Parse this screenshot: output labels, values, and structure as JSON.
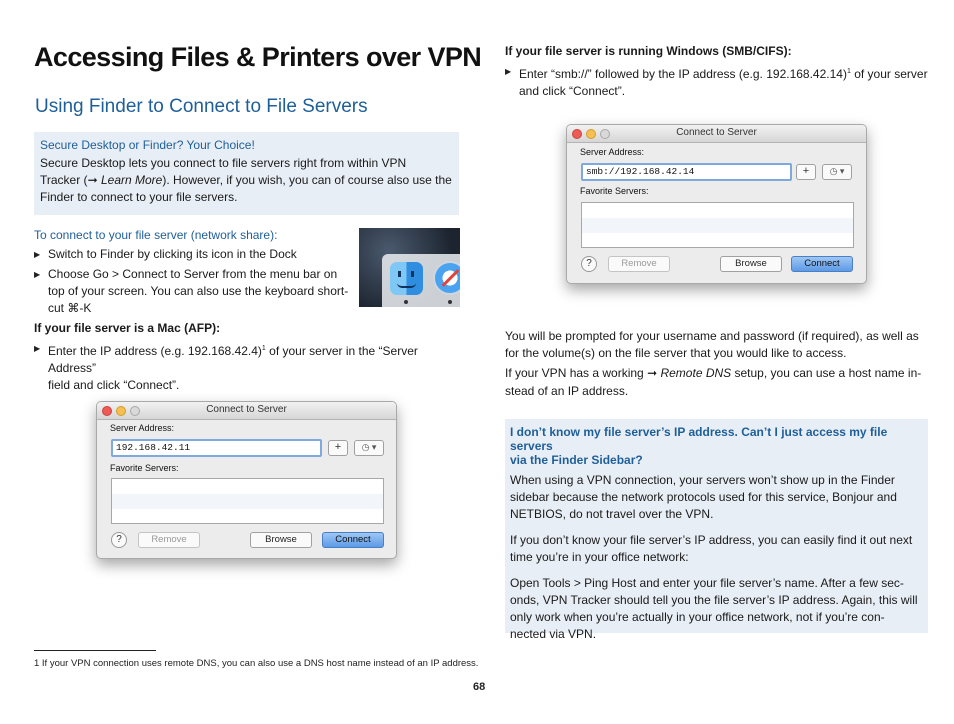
{
  "page_title": "Accessing Files & Printers over VPN",
  "section_title": "Using Finder to Connect to File Servers",
  "tip_box": {
    "title": "Secure Desktop or Finder? Your Choice!",
    "line1": "Secure Desktop lets you connect to file servers right from within VPN",
    "line2_prefix": "Tracker (",
    "arrow": "➞",
    "link": "Learn More",
    "line2_suffix": "). However, if you wish, you can of course also use the",
    "line3": "Finder to connect to your file servers."
  },
  "network_share": {
    "heading": "To connect to your file server (network share):",
    "bullets": [
      "Switch to Finder by clicking its icon in the Dock",
      "Choose Go > Connect to Server from the menu bar on",
      "top of your screen. You can also use the keyboard short-",
      "cut ⌘-K"
    ]
  },
  "mac_section": {
    "heading": "If your file server is a Mac (AFP):",
    "bullet_line1_a": "Enter the IP address (e.g. 192.168.42.4)",
    "footnote_ref": "1",
    "bullet_line1_b": " of your server in the “Server Address”",
    "bullet_line2": "field and click “Connect”."
  },
  "windows_section": {
    "heading": "If your file server is running Windows (SMB/CIFS):",
    "bullet_line1_a": "Enter “smb://” followed by the IP address (e.g. 192.168.42.14)",
    "footnote_ref": "1",
    "bullet_line1_b": " of your server",
    "bullet_line2": "and click “Connect”."
  },
  "dialog_mac": {
    "title": "Connect to Server",
    "server_label": "Server Address:",
    "server_value": "192.168.42.11",
    "plus": "+",
    "clock": "◷ ▾",
    "favorites_label": "Favorite Servers:",
    "help": "?",
    "remove": "Remove",
    "browse": "Browse",
    "connect": "Connect"
  },
  "dialog_win": {
    "title": "Connect to Server",
    "server_label": "Server Address:",
    "server_value": "smb://192.168.42.14",
    "plus": "+",
    "clock": "◷ ▾",
    "favorites_label": "Favorite Servers:",
    "help": "?",
    "remove": "Remove",
    "browse": "Browse",
    "connect": "Connect"
  },
  "prompt_text": {
    "line1": "You will be prompted for your username and password (if required), as well as",
    "line2": "for the volume(s) on the file server that you would like to access.",
    "line3_prefix": "If your VPN has a working ",
    "arrow": "➞",
    "link": "Remote DNS",
    "line3_suffix": " setup, you can use a host name in-",
    "line4": "stead of an IP address."
  },
  "faq_box": {
    "title_line1": "I don’t know my file server’s IP address. Can’t I just access my file servers",
    "title_line2": "via the Finder Sidebar?",
    "p1_l1": "When using a VPN connection, your servers won’t show up in the Finder",
    "p1_l2": "sidebar because the network protocols used for this service, Bonjour and",
    "p1_l3": "NETBIOS, do not travel over the VPN.",
    "p2_l1": "If you don’t know your file server’s IP address, you can easily find it out next",
    "p2_l2": "time you’re in your office network:",
    "p3_l1": "Open Tools > Ping Host and enter your file server’s name. After a few sec-",
    "p3_l2": "onds, VPN Tracker should tell you the file server’s IP address. Again, this will",
    "p3_l3": "only work when you’re actually in your office network, not if you’re con-",
    "p3_l4": "nected via VPN."
  },
  "footnote": "1 If your VPN connection uses remote DNS, you can also use a DNS host name instead of an IP address.",
  "page_number": "68",
  "colors": {
    "accent": "#1f5f99",
    "box_bg": "#e8eef5"
  }
}
